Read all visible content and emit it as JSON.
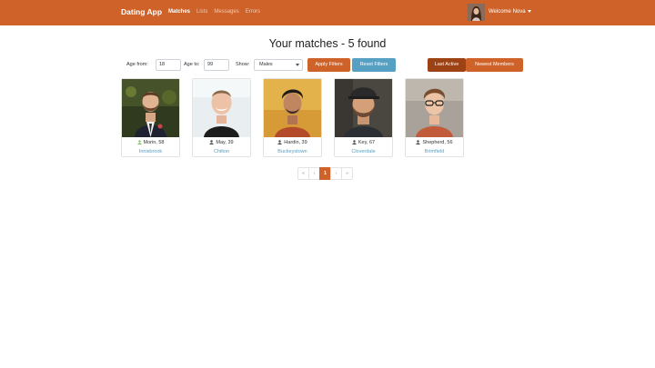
{
  "navbar": {
    "brand": "Dating App",
    "links": [
      "Matches",
      "Lists",
      "Messages",
      "Errors"
    ],
    "welcome": "Welcome Nova",
    "accent": "#ce6229"
  },
  "heading": "Your matches - 5 found",
  "filters": {
    "age_from_label": "Age from:",
    "age_from_value": "18",
    "age_to_label": "Age to:",
    "age_to_value": "99",
    "show_label": "Show:",
    "show_value": "Males",
    "apply_label": "Apply Filters",
    "reset_label": "Reset Filters",
    "last_active_label": "Last Active",
    "newest_label": "Newest Members"
  },
  "members": [
    {
      "name_age": "Morin, 58",
      "city": "Innisbrook",
      "online": true
    },
    {
      "name_age": "May, 39",
      "city": "Chilton",
      "online": false
    },
    {
      "name_age": "Hardin, 39",
      "city": "Buckeystown",
      "online": false
    },
    {
      "name_age": "Key, 67",
      "city": "Cloverdale",
      "online": false
    },
    {
      "name_age": "Shepherd, 56",
      "city": "Brimfield",
      "online": false
    }
  ],
  "pagination": {
    "first": "«",
    "prev": "‹",
    "current": "1",
    "next": "›",
    "last": "»"
  },
  "colors": {
    "online": "#7fbf5a",
    "offline": "#444444",
    "city": "#56a0c4"
  }
}
